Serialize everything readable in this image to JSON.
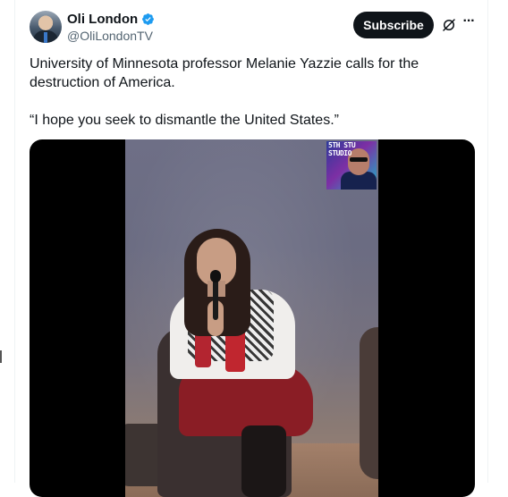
{
  "author": {
    "display_name": "Oli London",
    "handle": "@OliLondonTV",
    "verified": true,
    "avatar_icon": "profile-photo"
  },
  "header_actions": {
    "subscribe_label": "Subscribe",
    "grok_icon": "grok-icon",
    "more_icon": "more-icon"
  },
  "tweet": {
    "line1": "University of Minnesota professor Melanie Yazzie calls for the destruction of America.",
    "line2": "“I hope you seek to dismantle the United States.”"
  },
  "media": {
    "overlay_text": "5TH STU\nSTUDIO",
    "type": "video"
  },
  "colors": {
    "text_primary": "#0f1419",
    "text_secondary": "#536471",
    "verified_blue": "#1d9bf0",
    "button_bg": "#0f1419"
  }
}
